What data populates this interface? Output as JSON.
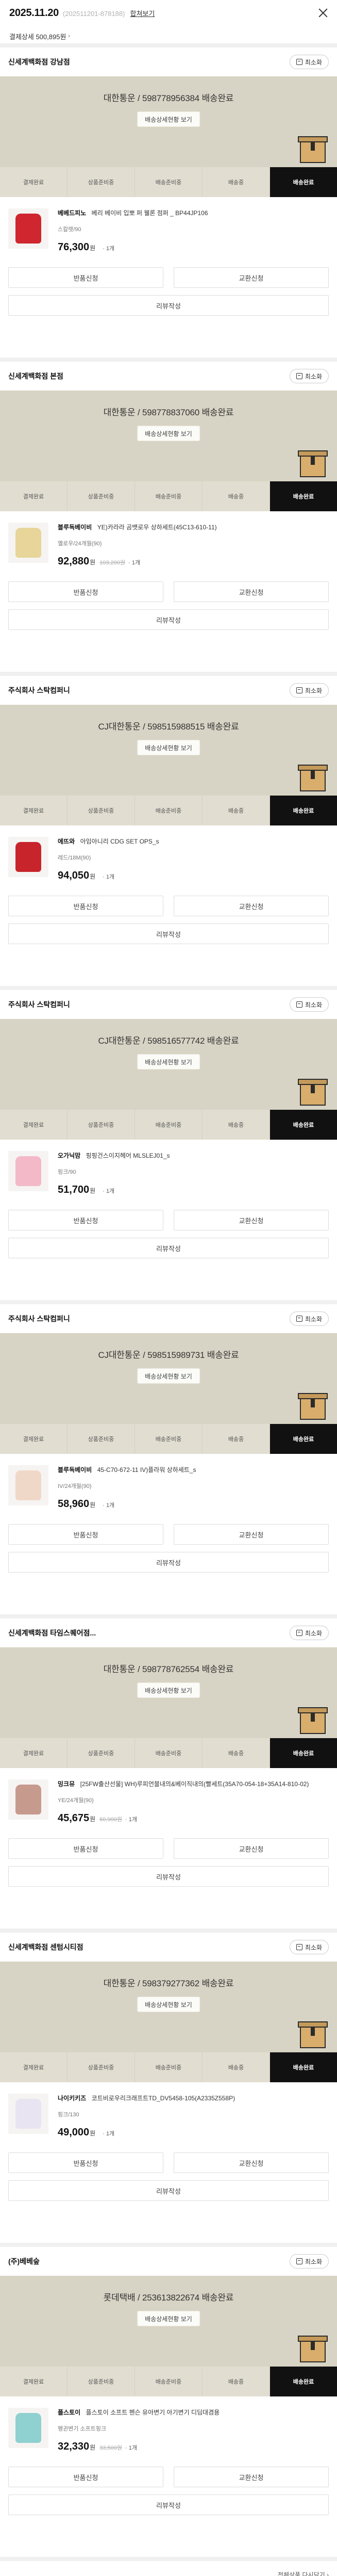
{
  "header": {
    "date": "2025.11.20",
    "order_no": "(202511201-878188)",
    "merged_view": "합쳐보기",
    "pay_detail": "결제상세 500,895원",
    "pay_chevron": "›"
  },
  "steps": [
    "결제완료",
    "상품준비중",
    "배송준비중",
    "배송중",
    "배송완료"
  ],
  "store_button": "최소화",
  "track_view_label": "배송상세현황 보기",
  "buttons": {
    "exchange_left": "반품신청",
    "exchange_right": "교환신청",
    "review": "리뷰작성"
  },
  "stores": [
    {
      "name": "신세계백화점 강남점",
      "shipping": "대한통운 / 598778956384 배송완료",
      "thumb_color": "#d0262f",
      "thumb_icon": "red-padded-jacket-icon",
      "brand": "베베드피노",
      "product": "베리 베이비 입뽀 퍼 웰론 점퍼 _ BP44JP106",
      "option": "스칼렛/90",
      "price": "76,300",
      "won": "원",
      "original_price": "",
      "qty": "· 1개"
    },
    {
      "name": "신세계백화점 본점",
      "shipping": "대한통운 / 598778837060 배송완료",
      "thumb_color": "#e7d59a",
      "thumb_icon": "baby-set-icon",
      "brand": "블루독베이비",
      "product": "YE)카라라 곰뱃로우 상하세트(45C13-610-11)",
      "option": "옐로우/24개월(90)",
      "price": "92,880",
      "won": "원",
      "original_price": "103,200원",
      "qty": "· 1개"
    },
    {
      "name": "주식회사 스탁컴퍼니",
      "shipping": "CJ대한통운 / 598515988515 배송완료",
      "thumb_color": "#c8242c",
      "thumb_icon": "red-dress-icon",
      "brand": "에뜨와",
      "product": "아임아니리 CDG SET OPS_s",
      "option": "레드/18M(90)",
      "price": "94,050",
      "won": "원",
      "original_price": "",
      "qty": "· 1개"
    },
    {
      "name": "주식회사 스탁컴퍼니",
      "shipping": "CJ대한통운 / 598516577742 배송완료",
      "thumb_color": "#f3b9c9",
      "thumb_icon": "pink-knit-icon",
      "brand": "오가닉맘",
      "product": "핑핑건스이지헤어 MLSLEJ01_s",
      "option": "핑크/90",
      "price": "51,700",
      "won": "원",
      "original_price": "",
      "qty": "· 1개"
    },
    {
      "name": "주식회사 스탁컴퍼니",
      "shipping": "CJ대한통운 / 598515989731 배송완료",
      "thumb_color": "#f0d8c8",
      "thumb_icon": "baby-set-icon",
      "brand": "블루독베이비",
      "product": "45-C70-672-11 IV)플라워 상하세트_s",
      "option": "IV/24개월(90)",
      "price": "58,960",
      "won": "원",
      "original_price": "",
      "qty": "· 1개"
    },
    {
      "name": "신세계백화점 타임스퀘어점...",
      "shipping": "대한통운 / 598778762554 배송완료",
      "thumb_color": "#c79a8e",
      "thumb_icon": "patterned-set-icon",
      "brand": "밍크뮤",
      "product": "[25FW출산선물] WH)루피언블내의&베이직내의(빨세트(35A70-054-18+35A14-810-02)",
      "option": "YE/24개월(90)",
      "price": "45,675",
      "won": "원",
      "original_price": "60,900원",
      "qty": "· 1개"
    },
    {
      "name": "신세계백화점 센텀시티점",
      "shipping": "대한통운 / 598379277362 배송완료",
      "thumb_color": "#e9e4f2",
      "thumb_icon": "shoes-icon",
      "brand": "나이키키즈",
      "product": "코트비로우리크래프트TD_DV5458-105(A2335Z558P)",
      "option": "핑크/130",
      "price": "49,000",
      "won": "원",
      "original_price": "",
      "qty": "· 1개"
    },
    {
      "name": "(주)베베숲",
      "shipping": "롯데택배 / 253613822674 배송완료",
      "thumb_color": "#8fd0d0",
      "thumb_icon": "baby-chair-icon",
      "brand": "플스토이",
      "product": "플스토이 소프트 펜슨 유아변기 아기변기 디딤대겸용",
      "option": "펭귄변기 소프트핑크",
      "price": "32,330",
      "won": "원",
      "original_price": "33,500원",
      "qty": "· 1개"
    }
  ],
  "footer": {
    "reorder": "전체상품 다시담기 ›"
  }
}
